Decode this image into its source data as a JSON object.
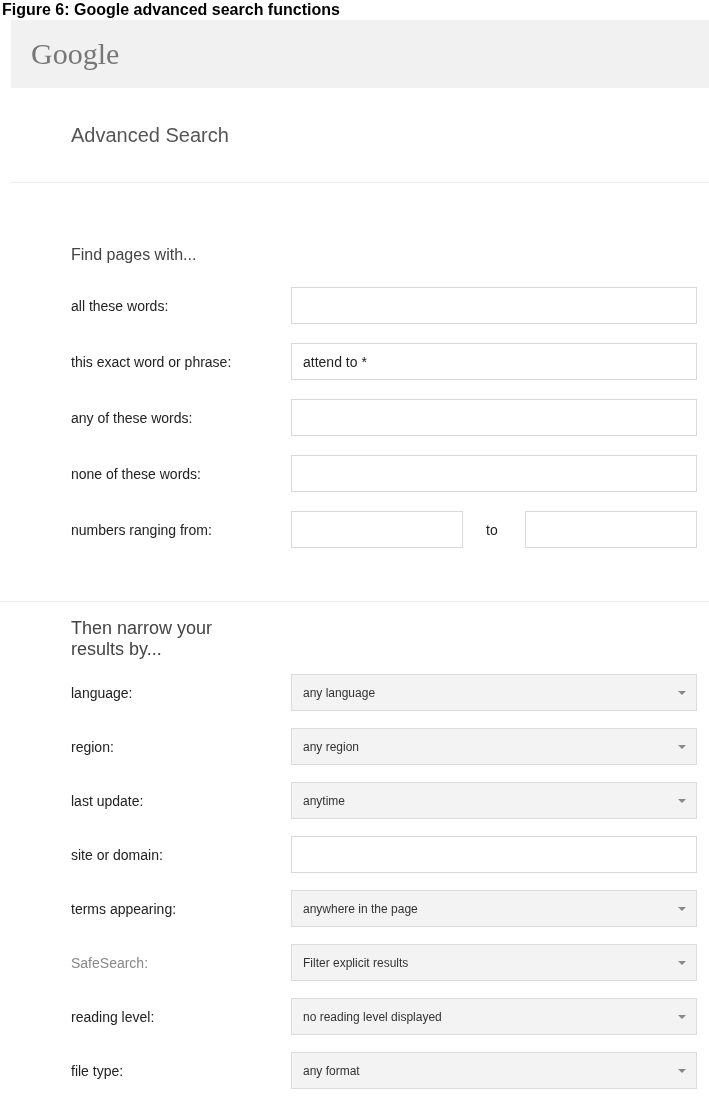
{
  "caption": "Figure 6: Google advanced search functions",
  "logo": "Google",
  "title": "Advanced Search",
  "sections": [
    {
      "heading": "Find pages with...",
      "rows": [
        {
          "label": "all these words:",
          "kind": "text",
          "dimmed": false
        },
        {
          "label": "this exact word or phrase:",
          "kind": "text",
          "value": "attend to *",
          "dimmed": false
        },
        {
          "label": "any of these words:",
          "kind": "text",
          "dimmed": false
        },
        {
          "label": "none of these words:",
          "kind": "text",
          "dimmed": false
        },
        {
          "label": "numbers ranging from:",
          "kind": "range",
          "separator": "to",
          "dimmed": false
        }
      ]
    },
    {
      "heading": "Then narrow your results by...",
      "rows": [
        {
          "label": "language:",
          "kind": "select",
          "value": "any language",
          "dimmed": false
        },
        {
          "label": "region:",
          "kind": "select",
          "value": "any region",
          "dimmed": false
        },
        {
          "label": "last update:",
          "kind": "select",
          "value": "anytime",
          "dimmed": false
        },
        {
          "label": "site or domain:",
          "kind": "text",
          "dimmed": false
        },
        {
          "label": "terms appearing:",
          "kind": "select",
          "value": "anywhere in the page",
          "dimmed": false
        },
        {
          "label": "SafeSearch:",
          "kind": "select",
          "value": "Filter explicit results",
          "dimmed": true
        },
        {
          "label": "reading level:",
          "kind": "select",
          "value": "no reading level displayed",
          "dimmed": false
        },
        {
          "label": "file type:",
          "kind": "select",
          "value": "any format",
          "dimmed": false
        }
      ]
    }
  ]
}
